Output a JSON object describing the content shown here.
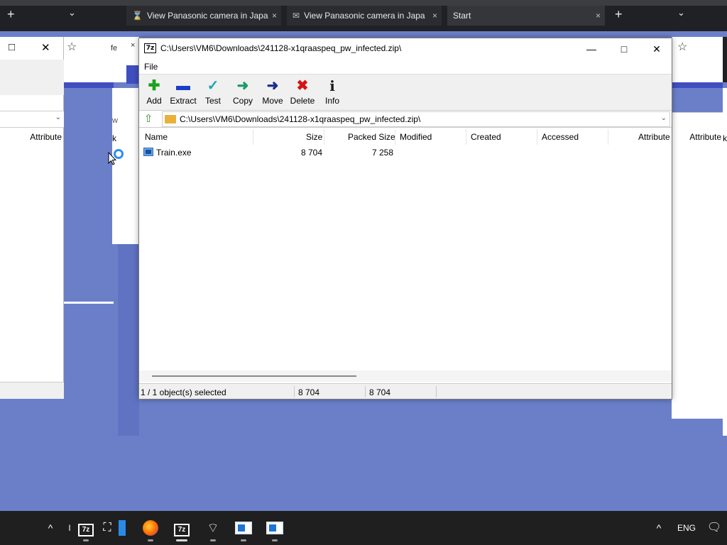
{
  "browser_tabs": {
    "tab1": "View Panasonic camera in Japa",
    "tab2": "View Panasonic camera in Japa",
    "tab3": "Start",
    "close": "×",
    "new_tab": "+",
    "dropdown": "⌄"
  },
  "bg_left_window": {
    "restore": "□",
    "close": "✕",
    "column": "Attribute",
    "dropdown": "⌄"
  },
  "bg_mid": {
    "star": "☆",
    "fe": "fe",
    "close": "×",
    "w": "w",
    "k": "k"
  },
  "bg_right": {
    "star": "☆",
    "column": "Attribute",
    "k": "k"
  },
  "window": {
    "title": "C:\\Users\\VM6\\Downloads\\241128-x1qraaspeq_pw_infected.zip\\",
    "app_icon_text": "7z",
    "minimize": "—",
    "maximize": "□",
    "close": "✕"
  },
  "menu": {
    "file": "File"
  },
  "toolbar": {
    "add": "Add",
    "extract": "Extract",
    "test": "Test",
    "copy": "Copy",
    "move": "Move",
    "delete": "Delete",
    "info": "Info",
    "icons": {
      "add": "✚",
      "extract": "▬",
      "test": "✓",
      "copy": "➜",
      "move": "➜",
      "delete": "✖",
      "info": "i"
    },
    "colors": {
      "add": "#1aa31a",
      "extract": "#1b3fc4",
      "test": "#19a9b3",
      "copy": "#1e9a6a",
      "move": "#1b2f8a",
      "delete": "#d41414",
      "info": "#1a1a1a"
    }
  },
  "address": {
    "path": "C:\\Users\\VM6\\Downloads\\241128-x1qraaspeq_pw_infected.zip\\",
    "up_icon": "⇧",
    "dropdown": "⌄"
  },
  "columns": [
    "Name",
    "Size",
    "Packed Size",
    "Modified",
    "Created",
    "Accessed",
    "Attribute"
  ],
  "files": [
    {
      "name": "Train.exe",
      "size": "8 704",
      "packed": "7 258"
    }
  ],
  "status": {
    "selection": "1 / 1 object(s) selected",
    "size": "8 704",
    "packed": "8 704"
  },
  "taskbar": {
    "chevron": "^",
    "seven_zip_text": "7z",
    "lang": "ENG",
    "pin": "I"
  },
  "colors": {
    "desktop": "#6b7fc9",
    "browser_chrome": "#202124",
    "accent_stripe": "#3f4fc0",
    "taskbar": "#1f1f1f"
  }
}
